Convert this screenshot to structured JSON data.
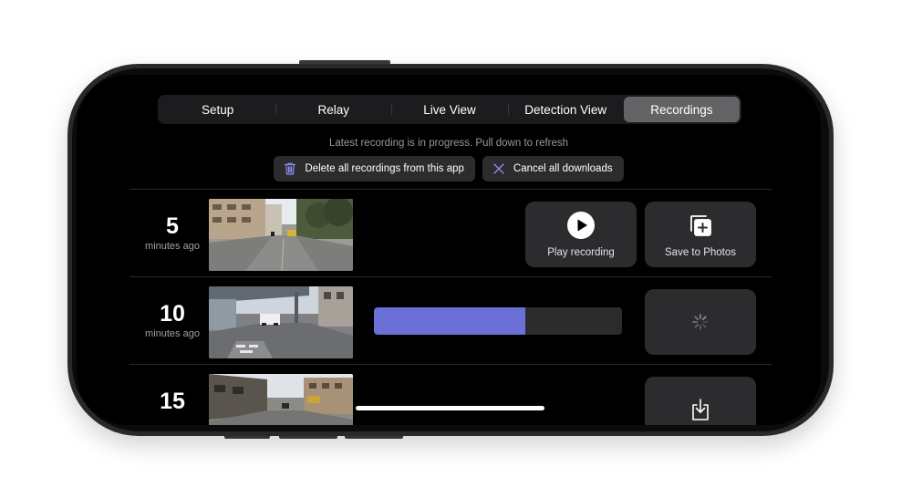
{
  "tabs": [
    {
      "label": "Setup",
      "active": false
    },
    {
      "label": "Relay",
      "active": false
    },
    {
      "label": "Live View",
      "active": false
    },
    {
      "label": "Detection View",
      "active": false
    },
    {
      "label": "Recordings",
      "active": true
    }
  ],
  "status_text": "Latest recording is in progress. Pull down to refresh",
  "actions": {
    "delete_all_label": "Delete all recordings from this app",
    "cancel_downloads_label": "Cancel all downloads"
  },
  "recordings": [
    {
      "age": "5",
      "unit": "minutes ago",
      "play_label": "Play recording",
      "save_label": "Save to Photos"
    },
    {
      "age": "10",
      "unit": "minutes ago",
      "download_progress": 0.61
    },
    {
      "age": "15"
    }
  ],
  "icons": {
    "trash": "trash-icon",
    "close": "x-icon",
    "play": "play-circle-icon",
    "save": "add-to-photos-icon",
    "spinner": "spinner-icon",
    "download": "download-icon"
  },
  "colors": {
    "screen_bg": "#000000",
    "control_bg": "#2c2c2e",
    "active_tab": "#636366",
    "accent": "#6b70d6",
    "icon_accent": "#8e8ff0"
  }
}
